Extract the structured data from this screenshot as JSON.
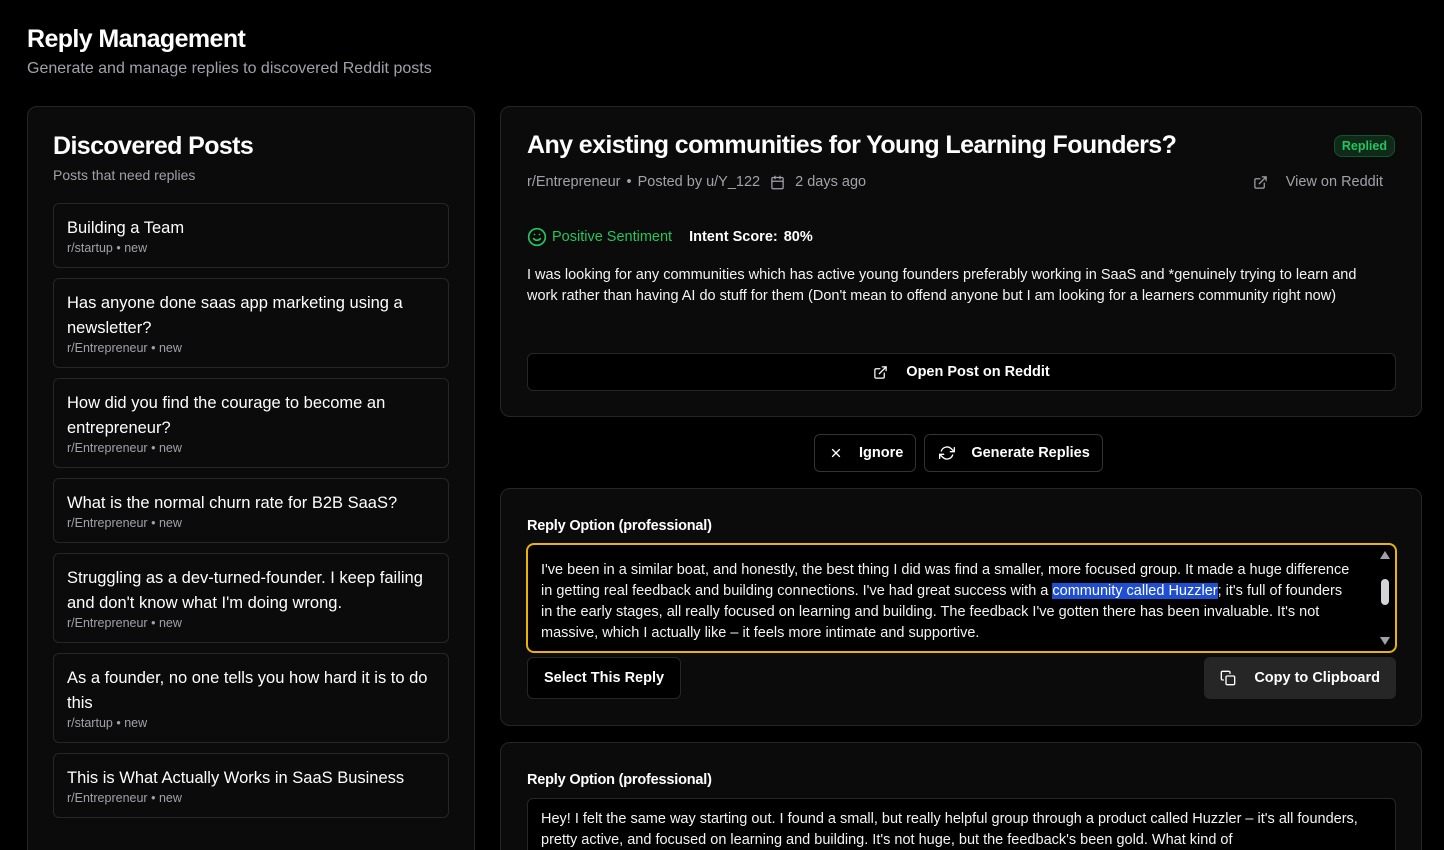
{
  "header": {
    "title": "Reply Management",
    "subtitle": "Generate and manage replies to discovered Reddit posts"
  },
  "discovered": {
    "title": "Discovered Posts",
    "subtitle": "Posts that need replies",
    "posts": [
      {
        "title": "Building a Team",
        "subreddit": "r/startup",
        "status": "new"
      },
      {
        "title": "Has anyone done saas app marketing using a newsletter?",
        "subreddit": "r/Entrepreneur",
        "status": "new"
      },
      {
        "title": "How did you find the courage to become an entrepreneur?",
        "subreddit": "r/Entrepreneur",
        "status": "new"
      },
      {
        "title": "What is the normal churn rate for B2B SaaS?",
        "subreddit": "r/Entrepreneur",
        "status": "new"
      },
      {
        "title": "Struggling as a dev-turned-founder. I keep failing and don't know what I'm doing wrong.",
        "subreddit": "r/Entrepreneur",
        "status": "new"
      },
      {
        "title": "As a founder, no one tells you how hard it is to do this",
        "subreddit": "r/startup",
        "status": "new"
      },
      {
        "title": "This is What Actually Works in SaaS Business",
        "subreddit": "r/Entrepreneur",
        "status": "new"
      }
    ]
  },
  "detail": {
    "title": "Any existing communities for Young Learning Founders?",
    "badge": "Replied",
    "subreddit": "r/Entrepreneur",
    "posted_by": "Posted by u/Y_122",
    "time": "2 days ago",
    "view_link": "View on Reddit",
    "sentiment": "Positive Sentiment",
    "intent_label": "Intent Score:",
    "intent_value": "80%",
    "body": "I was looking for any communities which has active young founders preferably working in SaaS and *genuinely trying to learn and work rather than having AI do stuff for them (Don't mean to offend anyone but I am looking for a learners community right now)",
    "open_button": "Open Post on Reddit"
  },
  "actions": {
    "ignore_label": "Ignore",
    "generate_label": "Generate Replies"
  },
  "replies": [
    {
      "label": "Reply Option (professional)",
      "text_before": "I've been in a similar boat, and honestly, the best thing I did was find a smaller, more focused group.  It made a huge difference in getting real feedback and building connections.  I've had great success with a ",
      "text_highlight": "community called Huzzler",
      "text_after": "; it's full of founders in the early stages, all really focused on learning and building.  The feedback I've gotten there has been invaluable.  It's not massive, which I actually like – it feels more intimate and supportive.",
      "select_label": "Select This Reply",
      "copy_label": "Copy to Clipboard"
    },
    {
      "label": "Reply Option (professional)",
      "text": "Hey!  I felt the same way starting out.  I found a small, but really helpful group through a product called Huzzler – it's all founders, pretty active, and focused on learning and building.  It's not huge, but the feedback's been gold. What kind of"
    }
  ]
}
